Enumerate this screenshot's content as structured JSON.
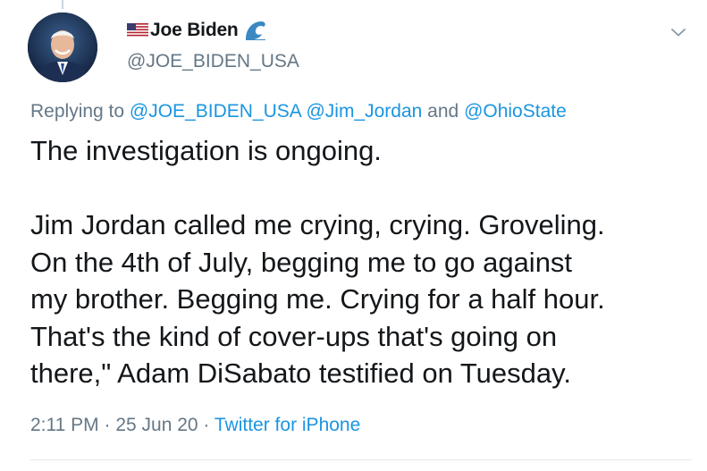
{
  "tweet": {
    "author": {
      "display_name": "Joe Biden",
      "handle": "@JOE_BIDEN_USA",
      "name_prefix_icon": "us-flag-icon",
      "name_suffix_icon": "wave-icon",
      "avatar": "avatar-photo"
    },
    "reply": {
      "prefix": "Replying to ",
      "mention_1": "@JOE_BIDEN_USA",
      "separator_1": " ",
      "mention_2": "@Jim_Jordan",
      "separator_2": " and ",
      "mention_3": "@OhioState"
    },
    "text": "The investigation is ongoing.\n\nJim Jordan called me crying, crying. Groveling.\nOn the 4th of July, begging me to go against\nmy brother. Begging me. Crying for a half hour.\nThat's the kind of cover-ups that's going on\nthere,\" Adam DiSabato testified on Tuesday.",
    "meta": {
      "time": "2:11 PM",
      "dot_1": " · ",
      "date": "25 Jun 20",
      "dot_2": " · ",
      "source": "Twitter for iPhone"
    },
    "menu_icon": "chevron-down-icon"
  },
  "colors": {
    "link": "#1b95e0",
    "secondary": "#657786",
    "text": "#14171a",
    "divider": "#e1e8ed"
  }
}
